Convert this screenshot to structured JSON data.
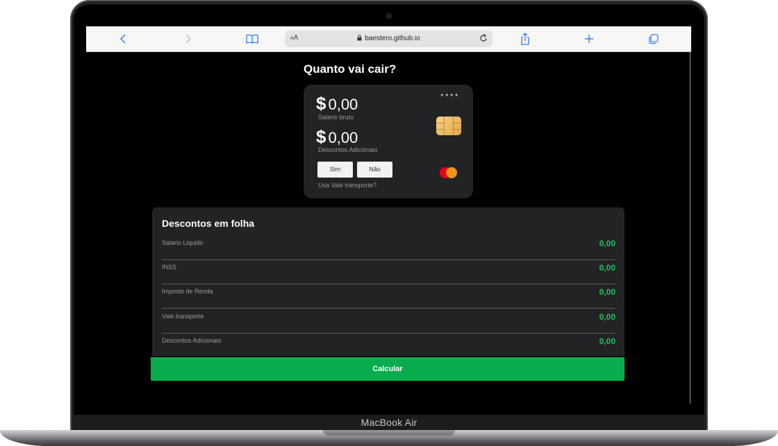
{
  "browser": {
    "url_domain": "baestero.github.io",
    "reader_label_small": "A",
    "reader_label_large": "A"
  },
  "device_label": "MacBook Air",
  "app": {
    "title": "Quanto vai cair?",
    "card": {
      "currency_symbol": "$",
      "gross_salary": "0,00",
      "gross_salary_label": "Salario bruto",
      "additional_discounts": "0,00",
      "additional_discounts_label": "Descontos Adicionais",
      "masked_number": "****",
      "option_yes": "Sim",
      "option_no": "Não",
      "transport_question": "Usa Vale transporte?"
    },
    "panel": {
      "title": "Descontos em folha",
      "rows": [
        {
          "label": "Salario Liquido",
          "value": "0,00"
        },
        {
          "label": "INSS",
          "value": "0,00"
        },
        {
          "label": "Imposto de Renda",
          "value": "0,00"
        },
        {
          "label": "Vale transporte",
          "value": "0,00"
        },
        {
          "label": "Descontos Adicionais",
          "value": "0,00"
        }
      ]
    },
    "calculate_label": "Calcular"
  },
  "colors": {
    "accent_green": "#09ad4d",
    "value_green": "#1fbf52",
    "card_bg": "#222325",
    "mastercard_red": "#eb001b",
    "mastercard_orange": "#f79e1b"
  }
}
